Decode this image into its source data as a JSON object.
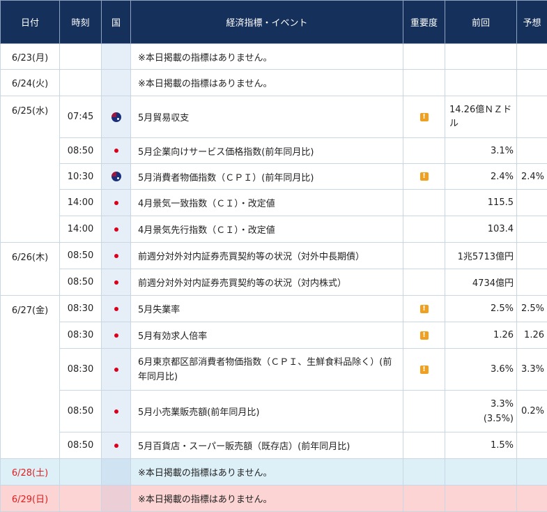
{
  "headers": {
    "date": "日付",
    "time": "時刻",
    "country": "国",
    "event": "経済指標・イベント",
    "importance": "重要度",
    "previous": "前回",
    "forecast": "予想"
  },
  "rows": [
    {
      "date": "6/23(月)",
      "time": "",
      "flag": "",
      "event": "※本日掲載の指標はありません。",
      "imp": "",
      "prev": "",
      "fore": ""
    },
    {
      "date": "6/24(火)",
      "time": "",
      "flag": "",
      "event": "※本日掲載の指標はありません。",
      "imp": "",
      "prev": "",
      "fore": ""
    },
    {
      "date": "6/25(水)",
      "time": "07:45",
      "flag": "nz-flag-icon",
      "event": "5月貿易収支",
      "imp": "!",
      "prev": "14.26億ＮＺドル",
      "fore": ""
    },
    {
      "date": "",
      "time": "08:50",
      "flag": "japan-flag-icon",
      "event": "5月企業向けサービス価格指数(前年同月比)",
      "imp": "",
      "prev": "3.1%",
      "fore": ""
    },
    {
      "date": "",
      "time": "10:30",
      "flag": "australia-flag-icon",
      "event": "5月消費者物価指数（ＣＰＩ）(前年同月比)",
      "imp": "!",
      "prev": "2.4%",
      "fore": "2.4%"
    },
    {
      "date": "",
      "time": "14:00",
      "flag": "japan-flag-icon",
      "event": "4月景気一致指数（ＣＩ）・改定値",
      "imp": "",
      "prev": "115.5",
      "fore": ""
    },
    {
      "date": "",
      "time": "14:00",
      "flag": "japan-flag-icon",
      "event": "4月景気先行指数（ＣＩ）・改定値",
      "imp": "",
      "prev": "103.4",
      "fore": ""
    },
    {
      "date": "6/26(木)",
      "time": "08:50",
      "flag": "japan-flag-icon",
      "event": "前週分対外対内証券売買契約等の状況（対外中長期債）",
      "imp": "",
      "prev": "1兆5713億円",
      "fore": ""
    },
    {
      "date": "",
      "time": "08:50",
      "flag": "japan-flag-icon",
      "event": "前週分対外対内証券売買契約等の状況（対内株式）",
      "imp": "",
      "prev": "4734億円",
      "fore": ""
    },
    {
      "date": "6/27(金)",
      "time": "08:30",
      "flag": "japan-flag-icon",
      "event": "5月失業率",
      "imp": "!",
      "prev": "2.5%",
      "fore": "2.5%"
    },
    {
      "date": "",
      "time": "08:30",
      "flag": "japan-flag-icon",
      "event": "5月有効求人倍率",
      "imp": "!",
      "prev": "1.26",
      "fore": "1.26"
    },
    {
      "date": "",
      "time": "08:30",
      "flag": "japan-flag-icon",
      "event": "6月東京都区部消費者物価指数（ＣＰＩ、生鮮食料品除く）(前年同月比)",
      "imp": "!",
      "prev": "3.6%",
      "fore": "3.3%"
    },
    {
      "date": "",
      "time": "08:50",
      "flag": "japan-flag-icon",
      "event": "5月小売業販売額(前年同月比)",
      "imp": "",
      "prev": "3.3%\n(3.5%)",
      "fore": "0.2%"
    },
    {
      "date": "",
      "time": "08:50",
      "flag": "japan-flag-icon",
      "event": "5月百貨店・スーパー販売額（既存店）(前年同月比)",
      "imp": "",
      "prev": "1.5%",
      "fore": ""
    },
    {
      "date": "6/28(土)",
      "time": "",
      "flag": "",
      "event": "※本日掲載の指標はありません。",
      "imp": "",
      "prev": "",
      "fore": ""
    },
    {
      "date": "6/29(日)",
      "time": "",
      "flag": "",
      "event": "※本日掲載の指標はありません。",
      "imp": "",
      "prev": "",
      "fore": ""
    }
  ],
  "colors": {
    "header_bg": "#15305b",
    "weekend_sat_bg": "#ddf0f8",
    "weekend_sun_bg": "#fcd4d4",
    "weekend_date_text": "#e02020",
    "importance_badge": "#f0a020",
    "japan_flag_red": "#d9001b"
  }
}
